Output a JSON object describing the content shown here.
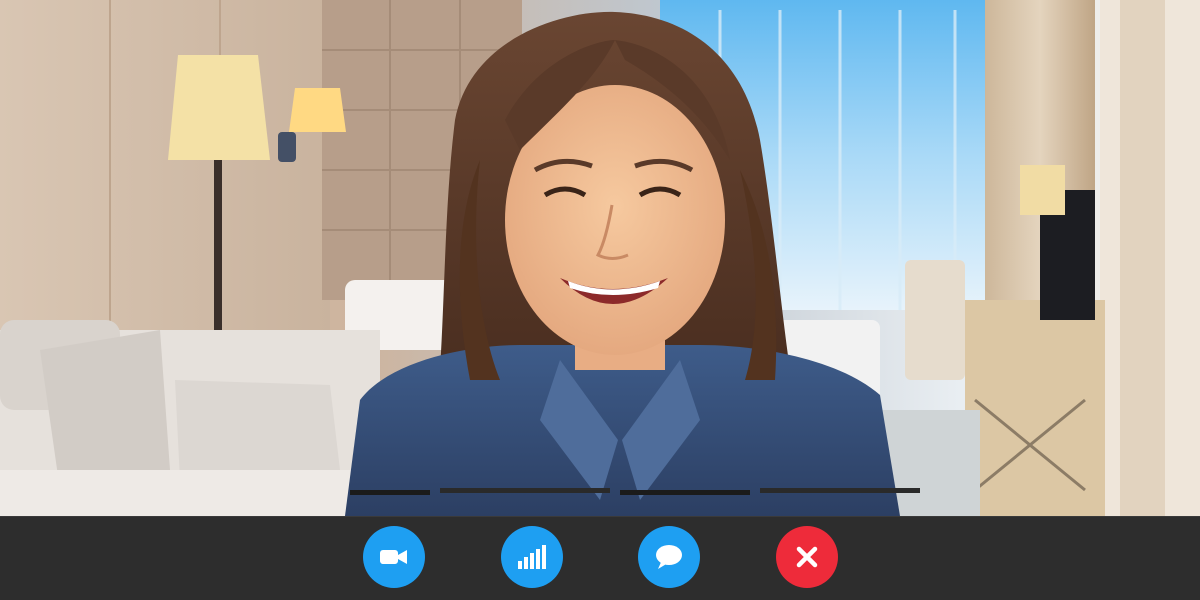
{
  "call": {
    "controls": [
      {
        "id": "camera",
        "icon": "video-camera-icon",
        "color": "#1e9ff2"
      },
      {
        "id": "signal",
        "icon": "signal-bars-icon",
        "color": "#1e9ff2"
      },
      {
        "id": "chat",
        "icon": "chat-bubble-icon",
        "color": "#1e9ff2"
      },
      {
        "id": "end",
        "icon": "close-icon",
        "color": "#ee2b3a"
      }
    ],
    "colors": {
      "bar_background": "#2d2d2d",
      "accent": "#1e9ff2",
      "danger": "#ee2b3a"
    }
  }
}
